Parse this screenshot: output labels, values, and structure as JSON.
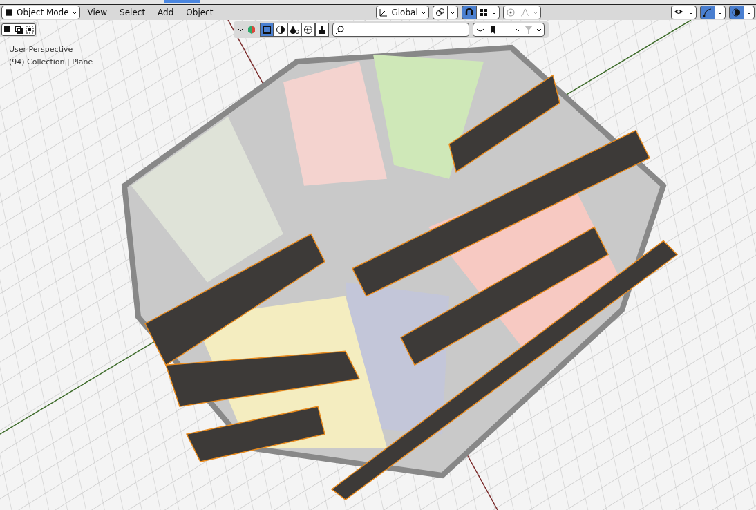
{
  "header": {
    "mode": "Object Mode",
    "menus": [
      "View",
      "Select",
      "Add",
      "Object"
    ],
    "orientation": "Global",
    "toggles": [
      {
        "kind": "pivot",
        "on": false
      },
      {
        "kind": "snap",
        "on": true
      },
      {
        "kind": "proportional",
        "on": false
      },
      {
        "kind": "visibility",
        "on": false
      },
      {
        "kind": "gizmo",
        "on": true
      },
      {
        "kind": "overlay",
        "on": true
      }
    ]
  },
  "shading": [
    {
      "kind": "solid-box",
      "selected": true
    },
    {
      "kind": "half",
      "selected": false
    },
    {
      "kind": "material",
      "selected": false
    },
    {
      "kind": "globe",
      "selected": false
    },
    {
      "kind": "brush",
      "selected": false
    }
  ],
  "viewport": {
    "view_name": "User Perspective",
    "object_info": "(94) Collection | Plane"
  }
}
